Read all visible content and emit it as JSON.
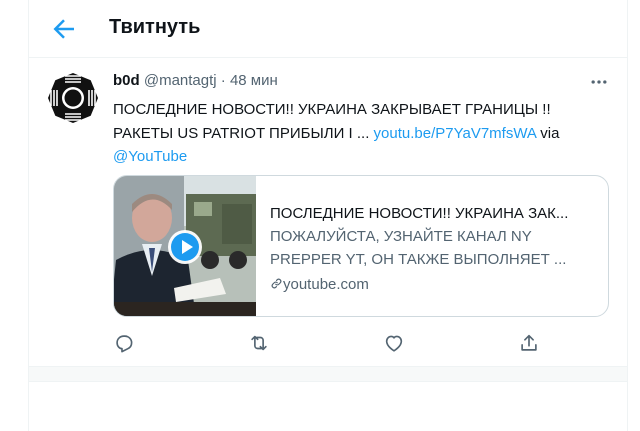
{
  "header": {
    "title": "Твитнуть"
  },
  "tweet": {
    "user": {
      "name": "b0d",
      "handle": "@mantagtj",
      "separator": "·",
      "time": "48 мин"
    },
    "text": {
      "line1": "ПОСЛЕДНИЕ НОВОСТИ!! УКРАИНА ЗАКРЫВАЕТ ГРАНИЦЫ !!",
      "line2": "РАКЕТЫ US PATRIOT ПРИБЫЛИ I ...",
      "link": "youtu.be/P7YaV7mfsWA",
      "via": "via",
      "mention": "@YouTube"
    },
    "card": {
      "title": "ПОСЛЕДНИЕ НОВОСТИ!! УКРАИНА ЗАК...",
      "desc_line1": "ПОЖАЛУЙСТА, УЗНАЙТЕ КАНАЛ NY",
      "desc_line2": "PREPPER YT, ОН ТАКЖЕ ВЫПОЛНЯЕТ ...",
      "domain": "youtube.com"
    },
    "icons": [
      "back-arrow-icon",
      "more-icon",
      "play-icon",
      "link-icon",
      "reply-icon",
      "retweet-icon",
      "like-icon",
      "share-icon"
    ],
    "colors": {
      "accent": "#1d9bf0",
      "secondary": "#536471",
      "border": "#cfd9de"
    }
  }
}
